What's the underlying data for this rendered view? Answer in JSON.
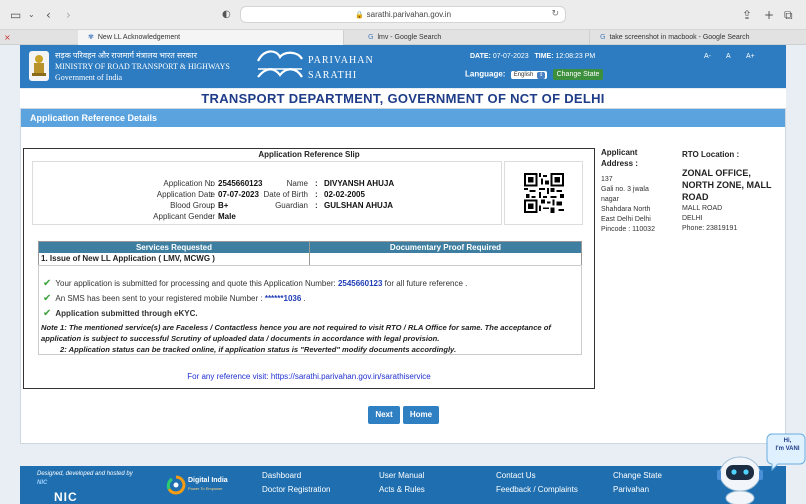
{
  "browser": {
    "url": "sarathi.parivahan.gov.in",
    "tabs": [
      {
        "title": "New LL Acknowledgement",
        "active": true
      },
      {
        "title": "lmv - Google Search",
        "active": false
      },
      {
        "title": "take screenshot in macbook - Google Search",
        "active": false
      }
    ]
  },
  "header": {
    "ministry_hindi": "सड़क परिवहन और राजमार्ग मंत्रालय भारत सरकार",
    "ministry_line1": "MINISTRY OF ROAD TRANSPORT & HIGHWAYS",
    "ministry_line2": "Government of India",
    "brand_line1": "PARIVAHAN",
    "brand_line2": "SARATHI",
    "date_label": "DATE:",
    "date_value": "07-07-2023",
    "time_label": "TIME:",
    "time_value": "12:08:23 PM",
    "language_label": "Language:",
    "language_value": "English",
    "change_state_label": "Change State",
    "font_small": "A-",
    "font_normal": "A",
    "font_large": "A+"
  },
  "department_title": "TRANSPORT DEPARTMENT, GOVERNMENT OF NCT OF DELHI",
  "card_title": "Application Reference Details",
  "slip": {
    "title": "Application Reference Slip",
    "application_no_label": "Application No",
    "application_no": "2545660123",
    "application_date_label": "Application Date",
    "application_date": "07-07-2023",
    "blood_group_label": "Blood Group",
    "blood_group": "B+",
    "gender_label": "Applicant Gender",
    "gender": "Male",
    "name_label": "Name",
    "name": "DIVYANSH AHUJA",
    "dob_label": "Date of Birth",
    "dob": "02-02-2005",
    "guardian_label": "Guardian",
    "guardian": "GULSHAN AHUJA",
    "services_header": "Services Requested",
    "proof_header": "Documentary Proof Required",
    "service_1": "1. Issue of New LL Application ( LMV, MCWG )",
    "msg1_pre": "Your application is submitted for processing and quote this Application Number: ",
    "msg1_num": "2545660123",
    "msg1_post": " for all future reference .",
    "msg2_pre": "An SMS has been sent to your registered mobile Number : ",
    "msg2_num": "******1036",
    "msg2_post": " .",
    "msg3": "Application submitted through eKYC.",
    "note1": "Note 1:  The mentioned service(s) are Faceless / Contactless hence you are not required to visit RTO / RLA Office for same. The acceptance of application is subject to successful Scrutiny of uploaded data / documents in accordance with legal provision.",
    "note2": "2:  Application status can be tracked online, if application status is \"Reverted\" modify documents accordingly.",
    "ref_link": "For any reference visit: https://sarathi.parivahan.gov.in/sarathiservice"
  },
  "address": {
    "label_line1": "Applicant",
    "label_line2": "Address :",
    "lines": [
      "137",
      "Gali no. 3 jwala",
      "nagar",
      "Shahdara North",
      "East Delhi Delhi",
      "Pincode : 110032"
    ]
  },
  "rto": {
    "label": "RTO Location :",
    "name": "ZONAL OFFICE, NORTH ZONE, MALL ROAD",
    "line1": "MALL ROAD",
    "line2": "DELHI",
    "phone": "Phone:  23819191"
  },
  "buttons": {
    "next": "Next",
    "home": "Home"
  },
  "footer": {
    "designed_by": "Designed, developed and hosted by",
    "nic_short": "NIC",
    "nic_logo": "NIC",
    "digital_india": "Digital India",
    "digital_india_tag": "Power To Empower",
    "col1": [
      "Dashboard",
      "Doctor Registration"
    ],
    "col2": [
      "User Manual",
      "Acts & Rules"
    ],
    "col3": [
      "Contact Us",
      "Feedback / Complaints"
    ],
    "col4": [
      "Change State",
      "Parivahan"
    ]
  },
  "bot": {
    "greeting_line1": "Hi,",
    "greeting_line2": "I'm VANI"
  }
}
